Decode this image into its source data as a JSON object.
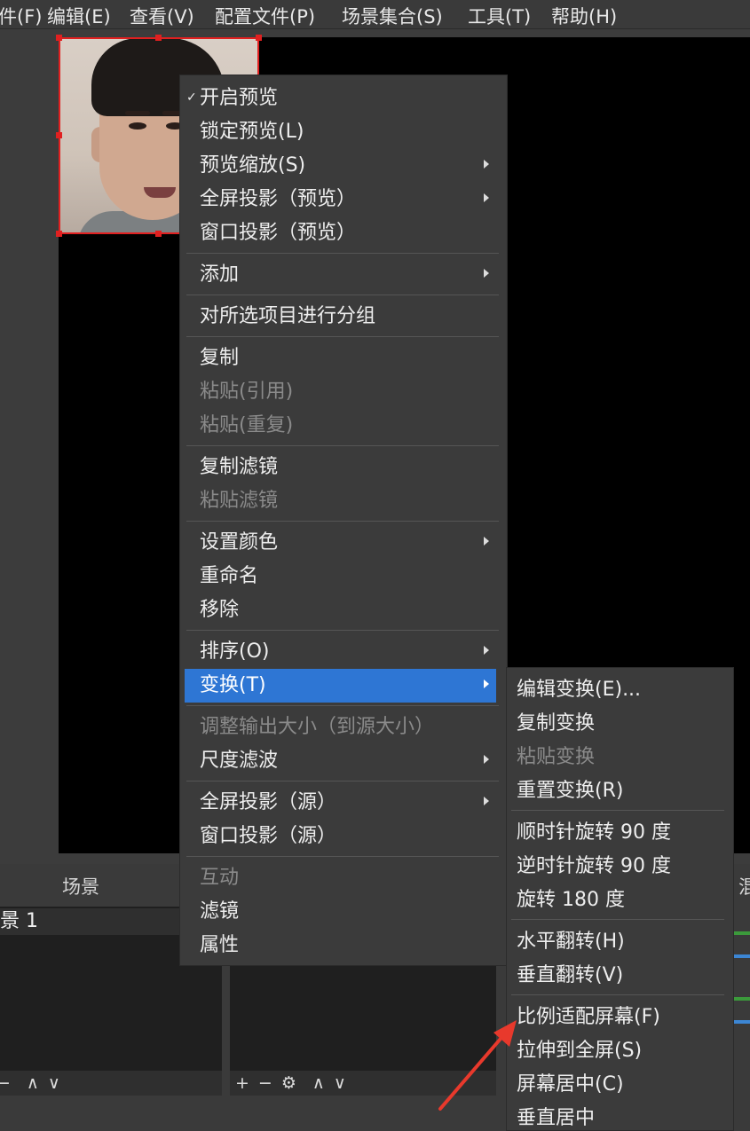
{
  "menubar": {
    "items": [
      "件(F)",
      "编辑(E)",
      "查看(V)",
      "配置文件(P)",
      "场景集合(S)",
      "工具(T)",
      "帮助(H)"
    ]
  },
  "docks": {
    "scenes_title": "场景",
    "scene_item": "景 1",
    "mixer_title": "混"
  },
  "context_menu": {
    "items": [
      {
        "label": "开启预览",
        "checked": true
      },
      {
        "label": "锁定预览(L)"
      },
      {
        "label": "预览缩放(S)",
        "submenu": true
      },
      {
        "label": "全屏投影（预览）",
        "submenu": true
      },
      {
        "label": "窗口投影（预览）"
      },
      {
        "label": "添加",
        "submenu": true
      },
      {
        "label": "对所选项目进行分组"
      },
      {
        "label": "复制"
      },
      {
        "label": "粘贴(引用)",
        "disabled": true
      },
      {
        "label": "粘贴(重复)",
        "disabled": true
      },
      {
        "label": "复制滤镜"
      },
      {
        "label": "粘贴滤镜",
        "disabled": true
      },
      {
        "label": "设置颜色",
        "submenu": true
      },
      {
        "label": "重命名"
      },
      {
        "label": "移除"
      },
      {
        "label": "排序(O)",
        "submenu": true
      },
      {
        "label": "变换(T)",
        "submenu": true,
        "highlighted": true
      },
      {
        "label": "调整输出大小（到源大小）",
        "disabled": true
      },
      {
        "label": "尺度滤波",
        "submenu": true
      },
      {
        "label": "全屏投影（源）",
        "submenu": true
      },
      {
        "label": "窗口投影（源）"
      },
      {
        "label": "互动",
        "disabled": true
      },
      {
        "label": "滤镜"
      },
      {
        "label": "属性"
      }
    ]
  },
  "transform_submenu": {
    "items": [
      {
        "label": "编辑变换(E)..."
      },
      {
        "label": "复制变换"
      },
      {
        "label": "粘贴变换",
        "disabled": true
      },
      {
        "label": "重置变换(R)"
      },
      {
        "label": "顺时针旋转 90 度"
      },
      {
        "label": "逆时针旋转 90 度"
      },
      {
        "label": "旋转 180 度"
      },
      {
        "label": "水平翻转(H)"
      },
      {
        "label": "垂直翻转(V)"
      },
      {
        "label": "比例适配屏幕(F)"
      },
      {
        "label": "拉伸到全屏(S)"
      },
      {
        "label": "屏幕居中(C)"
      },
      {
        "label": "垂直居中"
      }
    ]
  },
  "toolbar": {
    "scene_buttons": [
      "+",
      "−",
      "∧",
      "∨"
    ],
    "source_buttons": [
      "+",
      "−",
      "⚙",
      "∧",
      "∨"
    ]
  },
  "colors": {
    "highlight": "#2e76d4",
    "selection": "#e02020",
    "annotation": "#e8392c"
  }
}
